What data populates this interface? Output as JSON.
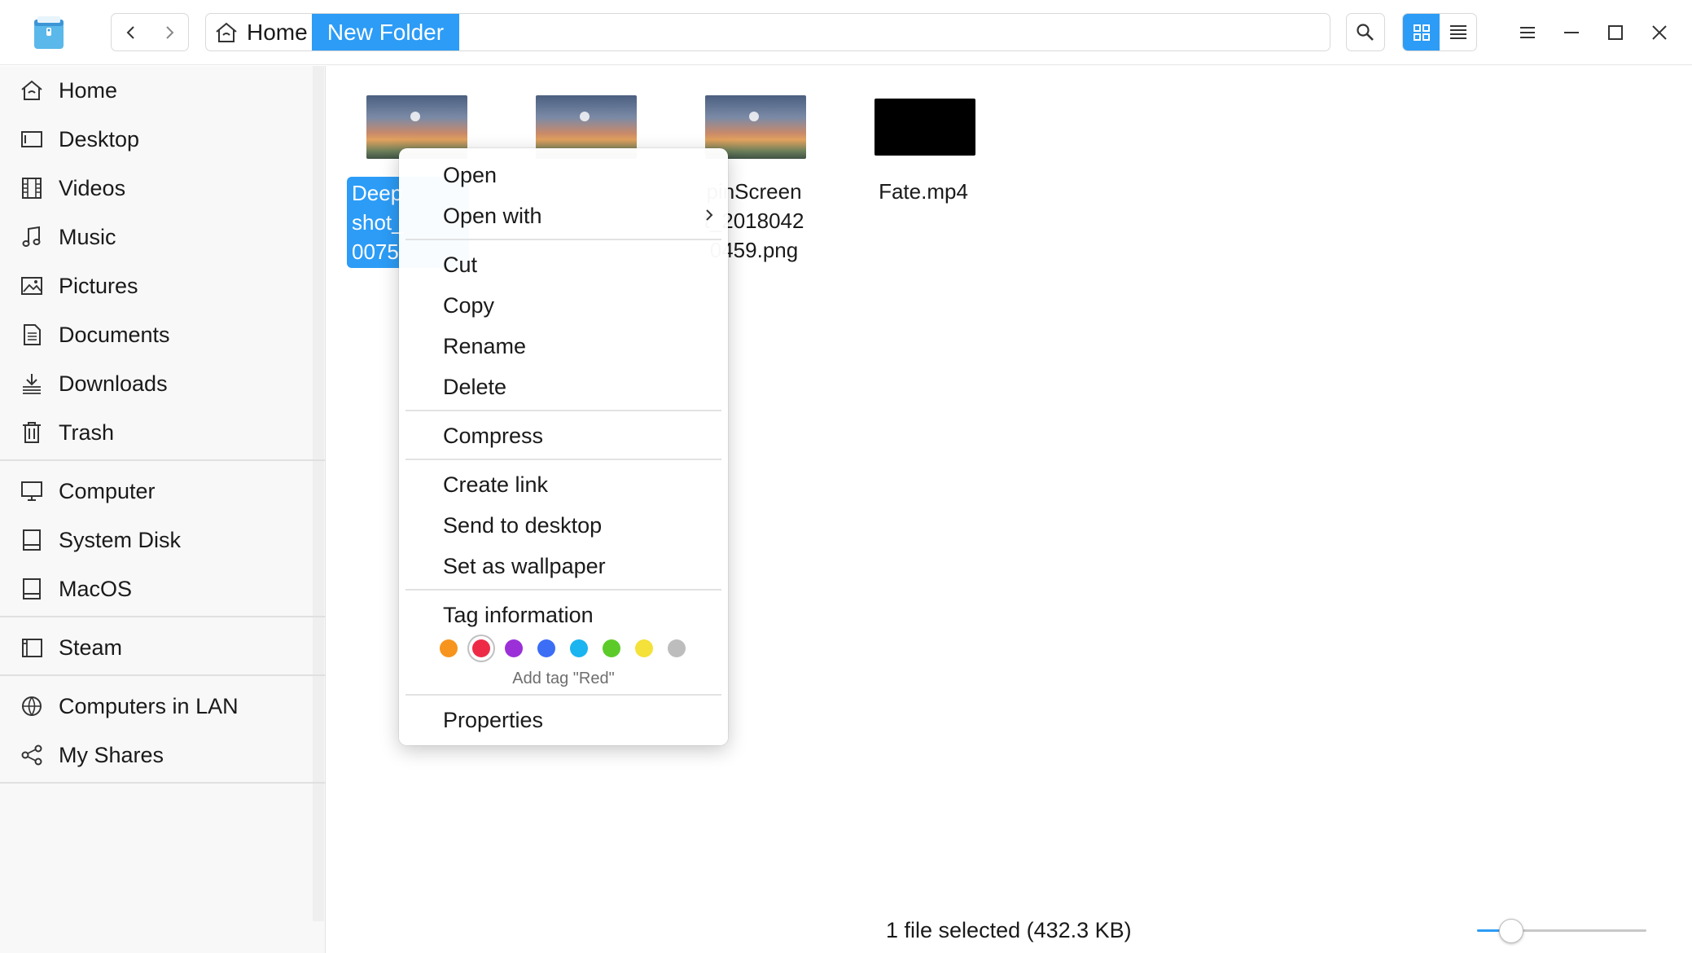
{
  "breadcrumb": {
    "home_label": "Home",
    "current_label": "New Folder"
  },
  "sidebar": {
    "items": [
      {
        "label": "Home",
        "icon": "home-icon"
      },
      {
        "label": "Desktop",
        "icon": "desktop-icon"
      },
      {
        "label": "Videos",
        "icon": "videos-icon"
      },
      {
        "label": "Music",
        "icon": "music-icon"
      },
      {
        "label": "Pictures",
        "icon": "pictures-icon"
      },
      {
        "label": "Documents",
        "icon": "documents-icon"
      },
      {
        "label": "Downloads",
        "icon": "downloads-icon"
      },
      {
        "label": "Trash",
        "icon": "trash-icon"
      },
      {
        "label": "Computer",
        "icon": "computer-icon"
      },
      {
        "label": "System Disk",
        "icon": "disk-icon"
      },
      {
        "label": "MacOS",
        "icon": "disk-icon"
      },
      {
        "label": "Steam",
        "icon": "steam-folder-icon"
      },
      {
        "label": "Computers in LAN",
        "icon": "network-icon"
      },
      {
        "label": "My Shares",
        "icon": "share-icon"
      }
    ]
  },
  "files": [
    {
      "name_lines": [
        "Deep",
        "shot_",
        "0075"
      ],
      "kind": "image",
      "selected": true
    },
    {
      "name_lines": [],
      "kind": "image",
      "selected": false
    },
    {
      "name_lines": [
        "pinScreen",
        "t_2018042",
        "0459.png"
      ],
      "kind": "image",
      "selected": false
    },
    {
      "name_lines": [
        "Fate.mp4"
      ],
      "kind": "video",
      "selected": false
    }
  ],
  "context_menu": {
    "open": "Open",
    "open_with": "Open with",
    "cut": "Cut",
    "copy": "Copy",
    "rename": "Rename",
    "delete": "Delete",
    "compress": "Compress",
    "create_link": "Create link",
    "send_to_desktop": "Send to desktop",
    "set_as_wallpaper": "Set as wallpaper",
    "tag_information": "Tag information",
    "tag_hint": "Add tag \"Red\"",
    "properties": "Properties",
    "tag_colors": [
      "#f7941d",
      "#ee2b47",
      "#9b30d9",
      "#3b6ef5",
      "#1ab4f0",
      "#5ccb29",
      "#f4e13a",
      "#bdbdbd"
    ]
  },
  "status": {
    "text": "1 file selected (432.3 KB)",
    "zoom_level": 0.2
  },
  "colors": {
    "accent": "#2c9cf6"
  }
}
